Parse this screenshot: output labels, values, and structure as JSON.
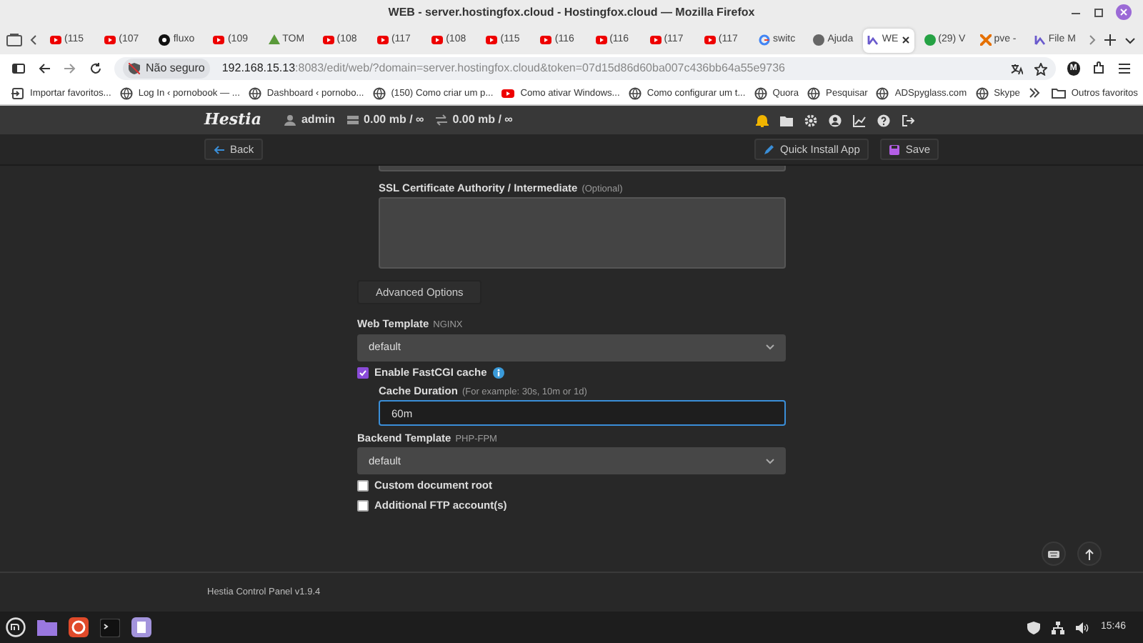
{
  "window": {
    "title": "WEB - server.hostingfox.cloud - Hostingfox.cloud — Mozilla Firefox"
  },
  "tabs": [
    {
      "kind": "video",
      "label": "(115",
      "selected": false
    },
    {
      "kind": "video",
      "label": "(107",
      "selected": false
    },
    {
      "kind": "dark",
      "label": "fluxo",
      "selected": false
    },
    {
      "kind": "video",
      "label": "(109",
      "selected": false
    },
    {
      "kind": "green",
      "label": "TOM",
      "selected": false
    },
    {
      "kind": "video",
      "label": "(108",
      "selected": false
    },
    {
      "kind": "video",
      "label": "(117",
      "selected": false
    },
    {
      "kind": "video",
      "label": "(108",
      "selected": false
    },
    {
      "kind": "video",
      "label": "(115",
      "selected": false
    },
    {
      "kind": "video",
      "label": "(116",
      "selected": false
    },
    {
      "kind": "video",
      "label": "(116",
      "selected": false
    },
    {
      "kind": "video",
      "label": "(117",
      "selected": false
    },
    {
      "kind": "video",
      "label": "(117",
      "selected": false
    },
    {
      "kind": "search",
      "label": "switc",
      "selected": false
    },
    {
      "kind": "grey",
      "label": "Ajuda",
      "selected": false
    },
    {
      "kind": "panel",
      "label": "WE",
      "selected": true
    },
    {
      "kind": "chat",
      "label": "(29) V",
      "selected": false
    },
    {
      "kind": "orange",
      "label": "pve -",
      "selected": false
    },
    {
      "kind": "panel",
      "label": "File M",
      "selected": false
    }
  ],
  "address": {
    "security": "Não seguro",
    "host": "192.168.15.13",
    "rest": ":8083/edit/web/?domain=server.hostingfox.cloud&token=07d15d86d60ba007c436bb64a55e9736",
    "avatar": "M"
  },
  "bookmarks": [
    {
      "kind": "import",
      "label": "Importar favoritos..."
    },
    {
      "kind": "globe",
      "label": "Log In ‹ pornobook — ..."
    },
    {
      "kind": "globe",
      "label": "Dashboard ‹ pornobo..."
    },
    {
      "kind": "globe",
      "label": "(150) Como criar um p..."
    },
    {
      "kind": "video",
      "label": "Como ativar Windows..."
    },
    {
      "kind": "globe",
      "label": "Como configurar um t..."
    },
    {
      "kind": "globe",
      "label": "Quora"
    },
    {
      "kind": "globe",
      "label": "Pesquisar"
    },
    {
      "kind": "globe",
      "label": "ADSpyglass.com"
    },
    {
      "kind": "globe",
      "label": "Skype"
    }
  ],
  "other_bookmarks": "Outros favoritos",
  "panel": {
    "logo": "Hestia",
    "user": "admin",
    "disk": "0.00 mb / ∞",
    "bandwidth": "0.00 mb / ∞"
  },
  "toolbar": {
    "back": "Back",
    "quick_install": "Quick Install App",
    "save": "Save"
  },
  "form": [
    {
      "kind": "group",
      "children": [
        {
          "kind": "edge"
        },
        {
          "kind": "textarea",
          "label": "SSL Certificate Authority / Intermediate",
          "hint": "(Optional)"
        }
      ]
    },
    {
      "kind": "button",
      "label": "Advanced Options"
    },
    {
      "kind": "select",
      "label": "Web Template",
      "hint": "NGINX",
      "value": "default"
    },
    {
      "kind": "checkbox",
      "label": "Enable FastCGI cache",
      "checked": true,
      "info": true,
      "children": [
        {
          "kind": "input",
          "label": "Cache Duration",
          "hint": "(For example: 30s, 10m or 1d)",
          "value": "60m",
          "focused": true
        }
      ]
    },
    {
      "kind": "select",
      "label": "Backend Template",
      "hint": "PHP-FPM",
      "value": "default"
    },
    {
      "kind": "checkbox",
      "label": "Custom document root",
      "checked": false
    },
    {
      "kind": "checkbox",
      "label": "Additional FTP account(s)",
      "checked": false
    }
  ],
  "footer": "Hestia Control Panel v1.9.4",
  "clock": "15:46"
}
